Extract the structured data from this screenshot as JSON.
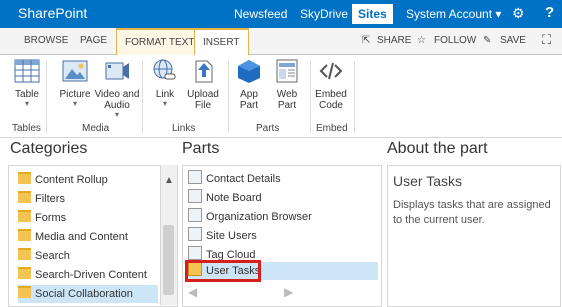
{
  "suitebar": {
    "brand": "SharePoint",
    "nav": [
      "Newsfeed",
      "SkyDrive",
      "Sites"
    ],
    "account": "System Account ▾",
    "help": "?"
  },
  "tabs": {
    "browse": "BROWSE",
    "page": "PAGE",
    "format_text": "FORMAT TEXT",
    "insert": "INSERT"
  },
  "actions": {
    "share": "SHARE",
    "follow": "FOLLOW",
    "save": "SAVE"
  },
  "ribbon": {
    "table": "Table",
    "picture": "Picture",
    "video_audio_1": "Video and",
    "video_audio_2": "Audio",
    "link": "Link",
    "upload_1": "Upload",
    "upload_2": "File",
    "app_part_1": "App",
    "app_part_2": "Part",
    "web_part_1": "Web",
    "web_part_2": "Part",
    "embed_1": "Embed",
    "embed_2": "Code",
    "groups": [
      "Tables",
      "Media",
      "Links",
      "Parts",
      "Embed"
    ]
  },
  "panes": {
    "categories_title": "Categories",
    "parts_title": "Parts",
    "about_title": "About the part"
  },
  "categories": [
    "Content Rollup",
    "Filters",
    "Forms",
    "Media and Content",
    "Search",
    "Search-Driven Content",
    "Social Collaboration"
  ],
  "parts": [
    "Contact Details",
    "Note Board",
    "Organization Browser",
    "Site Users",
    "Tag Cloud",
    "User Tasks"
  ],
  "about": {
    "name": "User Tasks",
    "description": "Displays tasks that are assigned to the current user."
  },
  "colors": {
    "suitebar": "#0072c6",
    "selection": "#cde6f7",
    "highlight_border": "#d62020",
    "contextual_tab": "#e8b44a"
  }
}
